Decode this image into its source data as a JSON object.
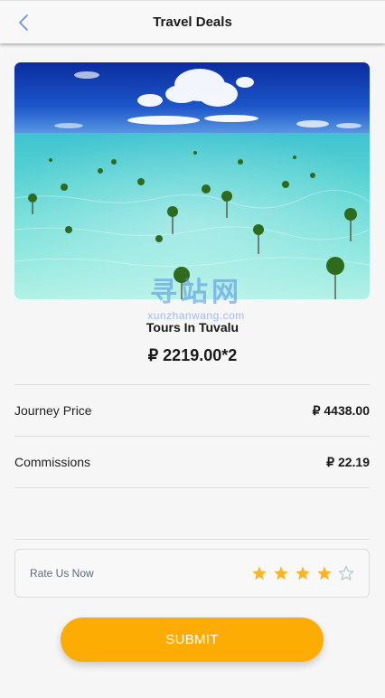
{
  "header": {
    "title": "Travel Deals",
    "back_icon": "chevron-left-icon",
    "back_color": "#6b8ed6"
  },
  "hero": {
    "image": "tropical shallow turquoise sea with mangrove sprouts under blue sky"
  },
  "tour": {
    "name": "Tours In Tuvalu",
    "price_line": "₽ 2219.00*2"
  },
  "watermark": {
    "cn": "寻站网",
    "en": "xunzhanwang.com"
  },
  "summary": {
    "journey_label": "Journey Price",
    "journey_value": "₽ 4438.00",
    "commission_label": "Commissions",
    "commission_value": "₽ 22.19"
  },
  "rating": {
    "label": "Rate Us Now",
    "value": 4,
    "max": 5,
    "filled_color": "#f5b727",
    "empty_color": "#b8c3d6"
  },
  "submit": {
    "label": "SUBMIT",
    "color": "#fdac04"
  }
}
